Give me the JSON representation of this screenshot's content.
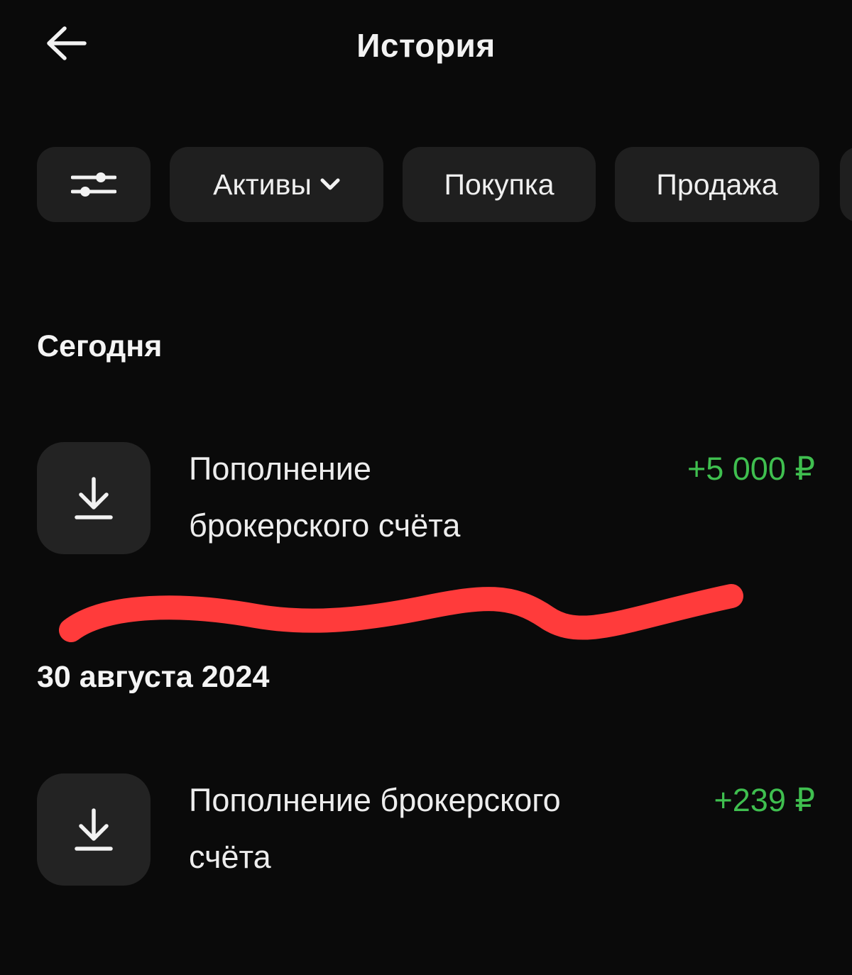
{
  "header": {
    "title": "История",
    "back_icon": "arrow-left-icon"
  },
  "filters": {
    "settings_icon": "sliders-icon",
    "chips": [
      {
        "label": "Активы",
        "has_dropdown": true
      },
      {
        "label": "Покупка"
      },
      {
        "label": "Продажа"
      }
    ]
  },
  "sections": [
    {
      "label": "Сегодня",
      "operations": [
        {
          "title_line1": "Пополнение",
          "title_line2": "брокерского счёта",
          "amount": "+5 000 ₽",
          "icon": "download-icon"
        }
      ]
    },
    {
      "label": "30 августа 2024",
      "operations": [
        {
          "title_line1": "Пополнение брокерского",
          "title_line2": "счёта",
          "amount": "+239 ₽",
          "icon": "download-icon"
        }
      ]
    }
  ],
  "colors": {
    "background": "#0a0a0a",
    "chip": "#1f1f1f",
    "icon_tile": "#232323",
    "positive_amount": "#3fbf4f",
    "redaction_mark": "#ff3b3b"
  }
}
